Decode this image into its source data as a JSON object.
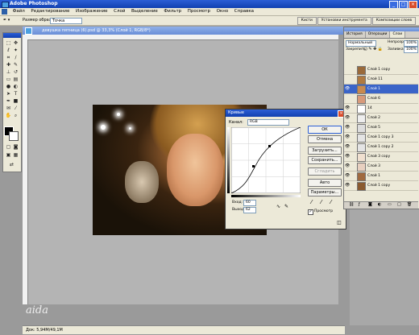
{
  "app": {
    "title": "Adobe Photoshop"
  },
  "menu": [
    "Файл",
    "Редактирование",
    "Изображение",
    "Слой",
    "Выделение",
    "Фильтр",
    "Просмотр",
    "Окно",
    "Справка"
  ],
  "options": {
    "sample_label": "Размер образца:",
    "sample_value": "Точка"
  },
  "wells": [
    "Кисти",
    "Установки инструмента",
    "Композиции слоев"
  ],
  "document": {
    "title": "девушка пятница (6).psd @ 33,3% (Слой 1, RGB/8*)"
  },
  "status": {
    "text": "Док: 5,94M/49,1M"
  },
  "signature": "aida",
  "curves": {
    "title": "Кривые",
    "channel_label": "Канал:",
    "channel_value": "RGB",
    "input_label": "Вход:",
    "input_value": "60",
    "output_label": "Выход:",
    "output_value": "62",
    "buttons": {
      "ok": "ОК",
      "cancel": "Отмена",
      "load": "Загрузить...",
      "save": "Сохранить...",
      "smooth": "Сгладить",
      "auto": "Авто",
      "options": "Параметры..."
    },
    "preview_label": "Просмотр",
    "preview_checked": true
  },
  "layers": {
    "tabs": [
      "История",
      "Операции",
      "Слои"
    ],
    "blend_mode": "Нормальный",
    "opacity_label": "Непрозр:",
    "opacity_value": "100%",
    "lock_label": "Закрепить:",
    "fill_label": "Заливка:",
    "fill_value": "100%",
    "items": [
      {
        "name": "Слой 1 copy",
        "selected": false
      },
      {
        "name": "Слой 11",
        "selected": false
      },
      {
        "name": "Слой 1",
        "selected": true
      },
      {
        "name": "Слой 6",
        "selected": false
      },
      {
        "name": "14",
        "selected": false
      },
      {
        "name": "Слой 2",
        "selected": false
      },
      {
        "name": "Слой 5",
        "selected": false
      },
      {
        "name": "Слой 1 copy 3",
        "selected": false
      },
      {
        "name": "Слой 1 copy 2",
        "selected": false
      },
      {
        "name": "Слой 3 copy",
        "selected": false
      },
      {
        "name": "Слой 3",
        "selected": false
      },
      {
        "name": "Слой 1",
        "selected": false
      },
      {
        "name": "Слой 1 copy",
        "selected": false
      }
    ]
  },
  "colors": {
    "accent": "#2c5fd6",
    "selected_layer": "#3a64c8",
    "foreground": "#000000",
    "background": "#ffffff"
  }
}
